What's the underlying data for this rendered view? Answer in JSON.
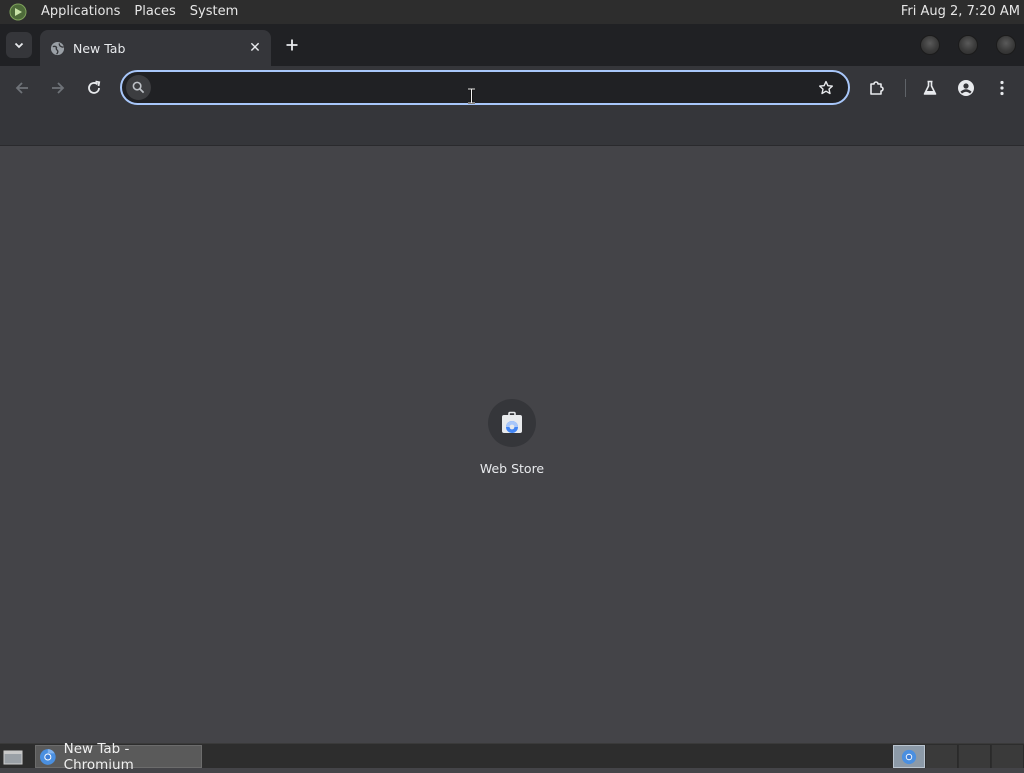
{
  "top_panel": {
    "menus": [
      "Applications",
      "Places",
      "System"
    ],
    "clock": "Fri Aug  2,  7:20 AM"
  },
  "browser": {
    "tab": {
      "title": "New Tab",
      "close_glyph": "✕"
    },
    "new_tab_glyph": "+",
    "omnibox": {
      "value": "",
      "placeholder": ""
    },
    "accent_color": "#a8c7fa"
  },
  "new_tab_page": {
    "shortcuts": [
      {
        "label": "Web Store"
      }
    ]
  },
  "taskbar": {
    "task_label": "New Tab - Chromium"
  },
  "icons": {
    "panel_logo": "distro-logo-icon",
    "tab_search": "chevron-down-icon",
    "tab_favicon": "globe-icon",
    "back": "arrow-left-icon",
    "forward": "arrow-right-icon",
    "reload": "reload-icon",
    "omnibox_search": "search-icon",
    "bookmark": "star-icon",
    "extensions": "puzzle-icon",
    "labs": "flask-icon",
    "profile": "person-icon",
    "menu": "kebab-menu-icon",
    "web_store": "web-store-icon",
    "chromium": "chromium-icon"
  }
}
